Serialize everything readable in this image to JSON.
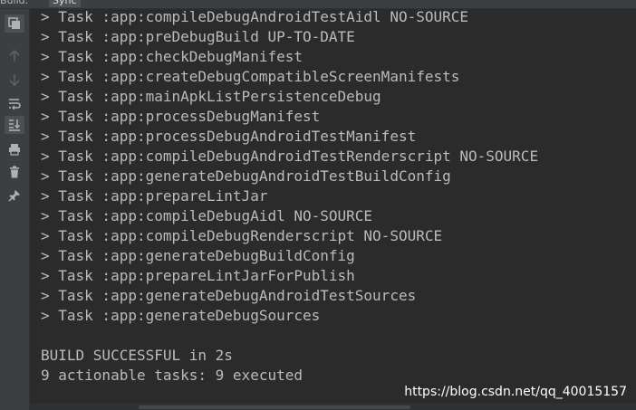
{
  "tabs": {
    "build": "Build:",
    "sync": "Sync"
  },
  "toolbar": {
    "icons": [
      "restore-icon",
      "up-arrow-icon",
      "down-arrow-icon",
      "soft-wrap-icon",
      "scroll-to-end-icon",
      "print-icon",
      "trash-icon",
      "pin-icon"
    ]
  },
  "console": {
    "lines": [
      "> Task :app:compileDebugAndroidTestAidl NO-SOURCE",
      "> Task :app:preDebugBuild UP-TO-DATE",
      "> Task :app:checkDebugManifest",
      "> Task :app:createDebugCompatibleScreenManifests",
      "> Task :app:mainApkListPersistenceDebug",
      "> Task :app:processDebugManifest",
      "> Task :app:processDebugAndroidTestManifest",
      "> Task :app:compileDebugAndroidTestRenderscript NO-SOURCE",
      "> Task :app:generateDebugAndroidTestBuildConfig",
      "> Task :app:prepareLintJar",
      "> Task :app:compileDebugAidl NO-SOURCE",
      "> Task :app:compileDebugRenderscript NO-SOURCE",
      "> Task :app:generateDebugBuildConfig",
      "> Task :app:prepareLintJarForPublish",
      "> Task :app:generateDebugAndroidTestSources",
      "> Task :app:generateDebugSources"
    ],
    "status_line_1": "BUILD SUCCESSFUL in 2s",
    "status_line_2": "9 actionable tasks: 9 executed"
  },
  "watermark": "https://blog.csdn.net/qq_40015157",
  "colors": {
    "background": "#2b2b2b",
    "toolbar": "#3c3f41",
    "text": "#bbbbbb",
    "icon": "#afb1b3"
  }
}
